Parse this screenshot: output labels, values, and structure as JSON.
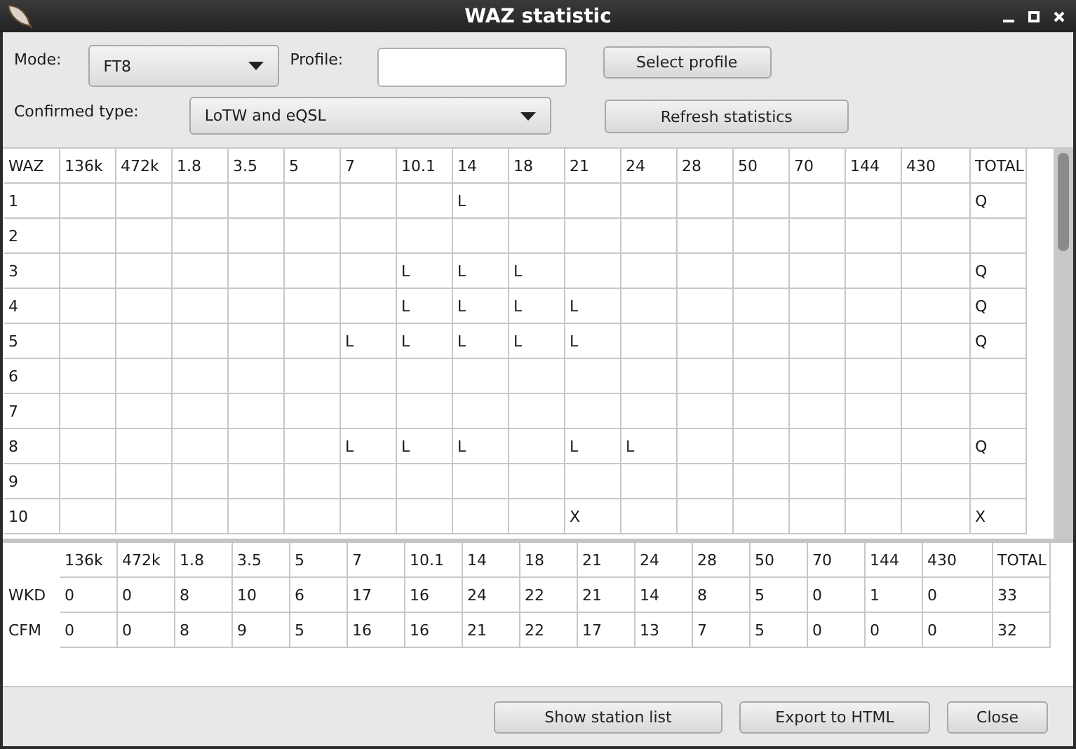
{
  "window": {
    "title": "WAZ statistic"
  },
  "form": {
    "mode": {
      "label": "Mode:",
      "value": "FT8"
    },
    "profile": {
      "label": "Profile:"
    },
    "select_profile": "Select profile",
    "confirmed_type": {
      "label": "Confirmed type:",
      "value": "LoTW and eQSL"
    },
    "refresh": "Refresh statistics"
  },
  "zone_table": {
    "columns": [
      "WAZ",
      "136k",
      "472k",
      "1.8",
      "3.5",
      "5",
      "7",
      "10.1",
      "14",
      "18",
      "21",
      "24",
      "28",
      "50",
      "70",
      "144",
      "430",
      "TOTAL"
    ],
    "rows": [
      {
        "cells": [
          "1",
          null,
          null,
          null,
          null,
          null,
          null,
          null,
          "L",
          null,
          null,
          null,
          null,
          null,
          null,
          null,
          null,
          "Q"
        ]
      },
      {
        "cells": [
          "2",
          null,
          null,
          null,
          null,
          null,
          null,
          null,
          null,
          null,
          null,
          null,
          null,
          null,
          null,
          null,
          null,
          null
        ]
      },
      {
        "cells": [
          "3",
          null,
          null,
          null,
          null,
          null,
          null,
          "L",
          "L",
          "L",
          null,
          null,
          null,
          null,
          null,
          null,
          null,
          "Q"
        ]
      },
      {
        "cells": [
          "4",
          null,
          null,
          null,
          null,
          null,
          null,
          "L",
          "L",
          "L",
          "L",
          null,
          null,
          null,
          null,
          null,
          null,
          "Q"
        ]
      },
      {
        "cells": [
          "5",
          null,
          null,
          null,
          null,
          null,
          "L",
          "L",
          "L",
          "L",
          "L",
          null,
          null,
          null,
          null,
          null,
          null,
          "Q"
        ]
      },
      {
        "cells": [
          "6",
          null,
          null,
          null,
          null,
          null,
          null,
          null,
          null,
          null,
          null,
          null,
          null,
          null,
          null,
          null,
          null,
          null
        ]
      },
      {
        "cells": [
          "7",
          null,
          null,
          null,
          null,
          null,
          null,
          null,
          null,
          null,
          null,
          null,
          null,
          null,
          null,
          null,
          null,
          null
        ]
      },
      {
        "cells": [
          "8",
          null,
          null,
          null,
          null,
          null,
          "L",
          "L",
          "L",
          null,
          "L",
          "L",
          null,
          null,
          null,
          null,
          null,
          "Q"
        ]
      },
      {
        "cells": [
          "9",
          null,
          null,
          null,
          null,
          null,
          null,
          null,
          null,
          null,
          null,
          null,
          null,
          null,
          null,
          null,
          null,
          null
        ]
      },
      {
        "cells": [
          "10",
          null,
          null,
          null,
          null,
          null,
          null,
          null,
          null,
          null,
          "X",
          null,
          null,
          null,
          null,
          null,
          null,
          "X"
        ]
      }
    ]
  },
  "summary_table": {
    "columns": [
      "136k",
      "472k",
      "1.8",
      "3.5",
      "5",
      "7",
      "10.1",
      "14",
      "18",
      "21",
      "24",
      "28",
      "50",
      "70",
      "144",
      "430",
      "TOTAL"
    ],
    "rows": [
      {
        "label": "WKD",
        "values": [
          "0",
          "0",
          "8",
          "10",
          "6",
          "17",
          "16",
          "24",
          "22",
          "21",
          "14",
          "8",
          "5",
          "0",
          "1",
          "0",
          "33"
        ]
      },
      {
        "label": "CFM",
        "values": [
          "0",
          "0",
          "8",
          "9",
          "5",
          "16",
          "16",
          "21",
          "22",
          "17",
          "13",
          "7",
          "5",
          "0",
          "0",
          "0",
          "32"
        ]
      }
    ]
  },
  "buttons": [
    "Show station list",
    "Export to HTML",
    "Close"
  ]
}
